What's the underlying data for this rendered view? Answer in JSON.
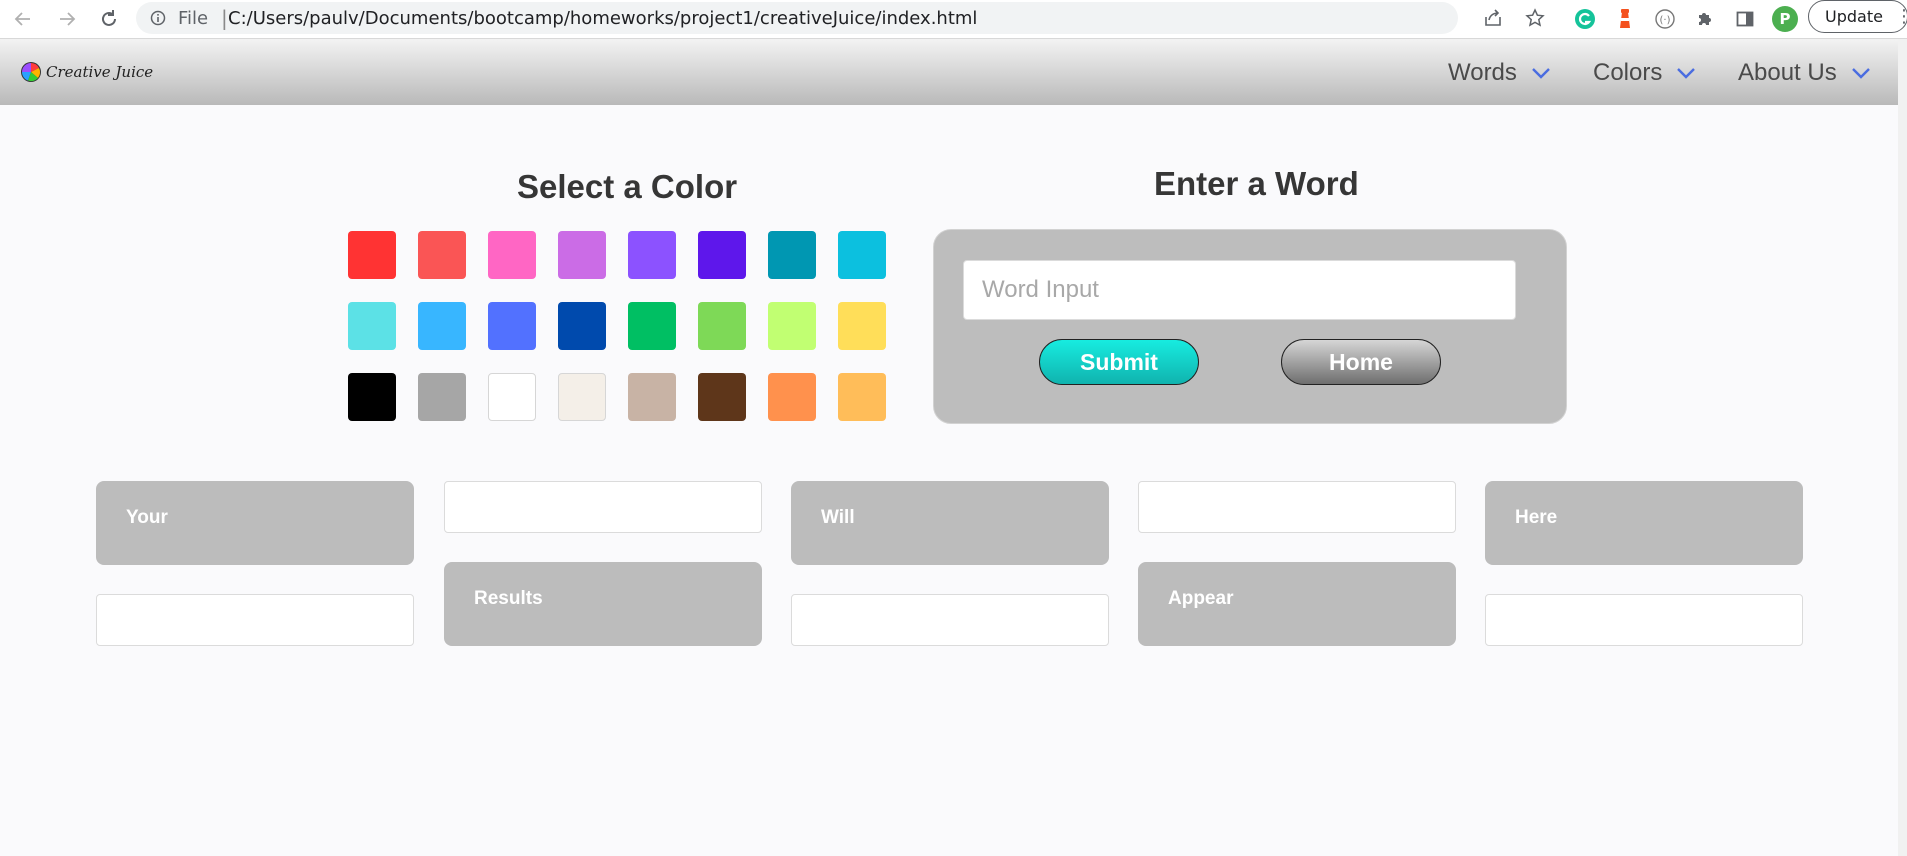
{
  "browser": {
    "file_label": "File",
    "separator": "|",
    "url": "C:/Users/paulv/Documents/bootcamp/homeworks/project1/creativeJuice/index.html",
    "profile_initial": "P",
    "update_label": "Update"
  },
  "nav": {
    "logo_text": "Creative Juice",
    "items": [
      {
        "label": "Words"
      },
      {
        "label": "Colors"
      },
      {
        "label": "About Us"
      }
    ]
  },
  "color_section": {
    "title": "Select a Color",
    "swatches": [
      "#ff3333",
      "#fa5555",
      "#ff66c4",
      "#cb6ce6",
      "#8c52ff",
      "#5e17eb",
      "#0097b2",
      "#0cc0df",
      "#5ce1e6",
      "#38b6ff",
      "#5271ff",
      "#004aad",
      "#00bf63",
      "#7ed957",
      "#c1ff72",
      "#ffde59",
      "#000000",
      "#a6a6a6",
      "#ffffff",
      "#f4efe8",
      "#c8b3a5",
      "#5e361a",
      "#ff914d",
      "#ffbd59"
    ]
  },
  "word_section": {
    "title": "Enter a Word",
    "input_placeholder": "Word Input",
    "input_value": "",
    "submit_label": "Submit",
    "home_label": "Home"
  },
  "results": {
    "cards": [
      "Your",
      "Results",
      "Will",
      "Appear",
      "Here"
    ]
  }
}
